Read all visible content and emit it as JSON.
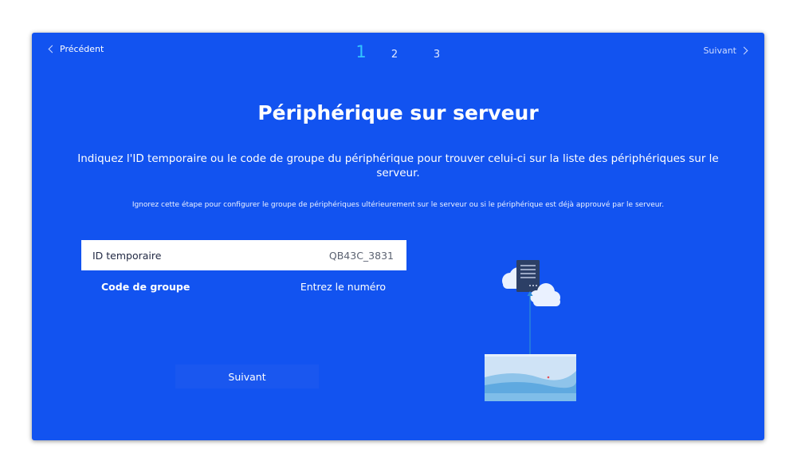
{
  "nav": {
    "prev_label": "Précédent",
    "next_label": "Suivant",
    "prev_icon": "chevron-left-icon",
    "next_icon": "chevron-right-icon"
  },
  "steps": {
    "items": [
      "1",
      "2",
      "3"
    ],
    "current": "1"
  },
  "page": {
    "title": "Périphérique sur serveur",
    "instruction": "Indiquez l'ID temporaire ou le code de groupe du périphérique pour trouver celui-ci sur la liste des périphériques sur le serveur.",
    "note": "Ignorez cette étape pour configurer le groupe de périphériques ultérieurement sur le serveur ou si le périphérique est déjà approuvé par le serveur."
  },
  "form": {
    "rows": [
      {
        "label": "ID temporaire",
        "value": "QB43C_3831",
        "selected": true
      },
      {
        "label": "Code de groupe",
        "value": "Entrez le numéro",
        "selected": false
      }
    ],
    "submit_label": "Suivant"
  },
  "illustration": {
    "icon": "server-cloud-sync-icon"
  },
  "colors": {
    "background": "#1253f0",
    "accent": "#32c4ff",
    "text": "#ffffff"
  }
}
